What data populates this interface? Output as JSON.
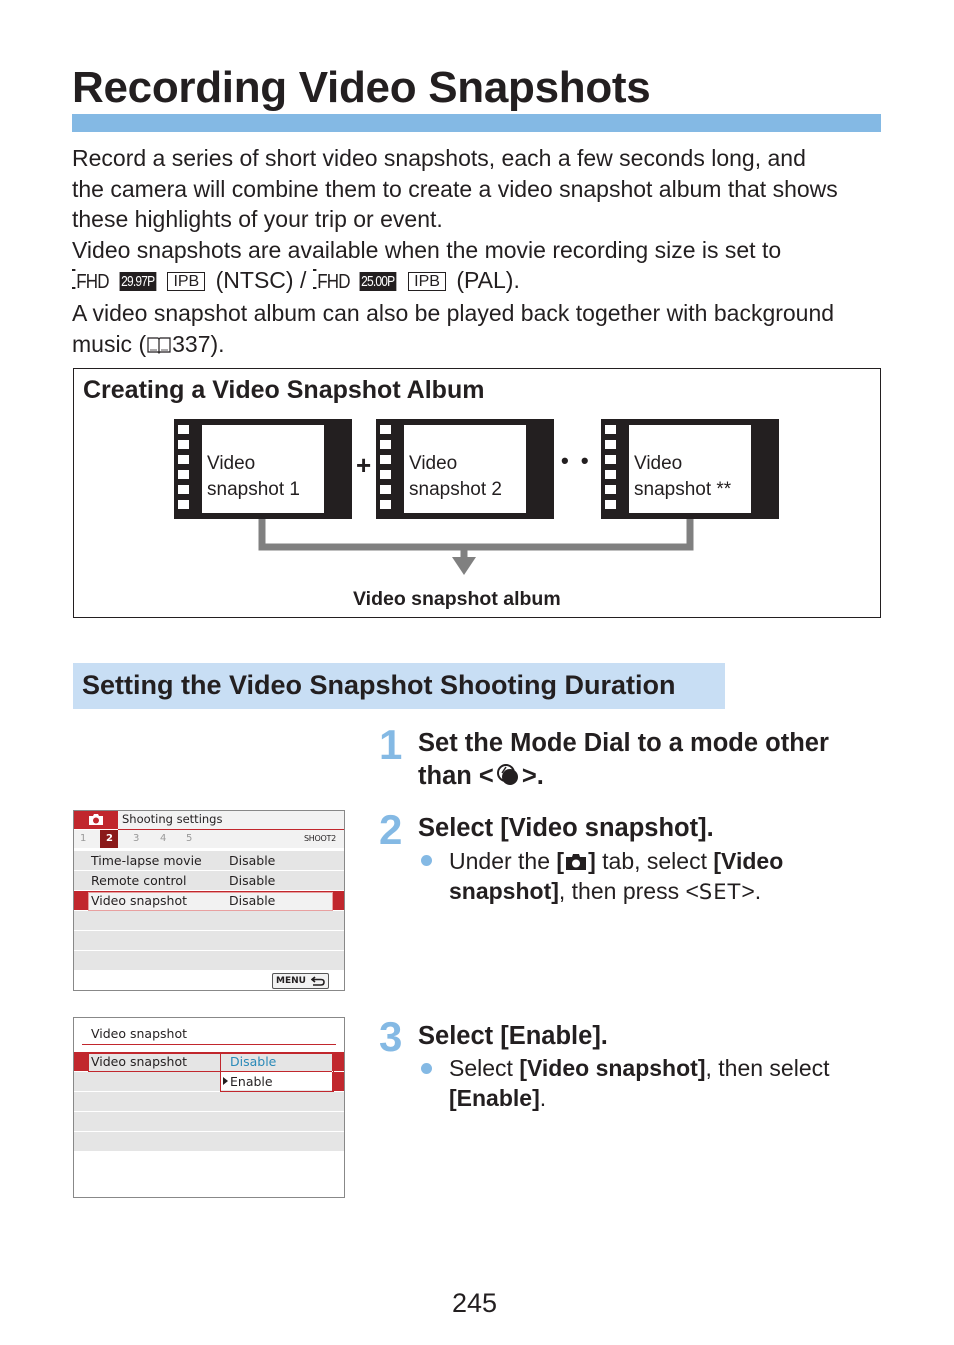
{
  "title": "Recording Video Snapshots",
  "intro": {
    "line1": "Record a series of short video snapshots, each a few seconds long, and",
    "line2": "the camera will combine them to create a video snapshot album that shows",
    "line3": "these highlights of your trip or event.",
    "line4": "Video snapshots are available when the movie recording size is set to",
    "ntsc_rate": "29.97P",
    "pal_rate": "25.00P",
    "fhd_label": "FHD",
    "ipb_label": "IPB",
    "ntsc_label": "(NTSC) /",
    "pal_label": "(PAL).",
    "line6": "A video snapshot album can also be played back together with background",
    "line7_pre": "music (",
    "line7_page": "337).",
    "book_icon": "book-icon"
  },
  "diagram": {
    "title": "Creating a Video Snapshot Album",
    "snapshots": [
      {
        "line1": "Video",
        "line2": "snapshot 1"
      },
      {
        "line1": "Video",
        "line2": "snapshot 2"
      },
      {
        "line1": "Video",
        "line2": "snapshot **"
      }
    ],
    "plus": "+",
    "ellipsis": "• • •",
    "album_label": "Video snapshot album"
  },
  "section": {
    "heading": "Setting the Video Snapshot Shooting Duration"
  },
  "steps": [
    {
      "num": "1",
      "title_line1": "Set the Mode Dial to a mode other",
      "title_line2_pre": "than <",
      "title_line2_post": ">.",
      "icon": "creative-assist-icon"
    },
    {
      "num": "2",
      "title": "Select [Video snapshot].",
      "bullet_pre": "Under the ",
      "bullet_b1_open": "[",
      "bullet_b1_close": "]",
      "bullet_mid": " tab, select ",
      "bullet_b2": "[Video",
      "bullet_b3": "snapshot]",
      "bullet_post": ", then press <",
      "set_label": "SET",
      "bullet_end": ">."
    },
    {
      "num": "3",
      "title": "Select [Enable].",
      "bullet_pre": "Select ",
      "bullet_b1": "[Video snapshot]",
      "bullet_mid": ", then select",
      "bullet_b2": "[Enable]",
      "bullet_end": "."
    }
  ],
  "screen1": {
    "header": "Shooting settings",
    "tabs": [
      "1",
      "2",
      "3",
      "4",
      "5"
    ],
    "active_tab": "2",
    "tab_id": "SHOOT2",
    "items": [
      {
        "label": "Time-lapse movie",
        "value": "Disable"
      },
      {
        "label": "Remote control",
        "value": "Disable"
      },
      {
        "label": "Video snapshot",
        "value": "Disable"
      }
    ],
    "menu_button": "MENU",
    "accent": "#c1272d"
  },
  "screen2": {
    "header": "Video snapshot",
    "item_label": "Video snapshot",
    "options": [
      "Disable",
      "Enable"
    ],
    "selected": "Enable",
    "option_color": "#2a8ab8"
  },
  "page_number": "245"
}
